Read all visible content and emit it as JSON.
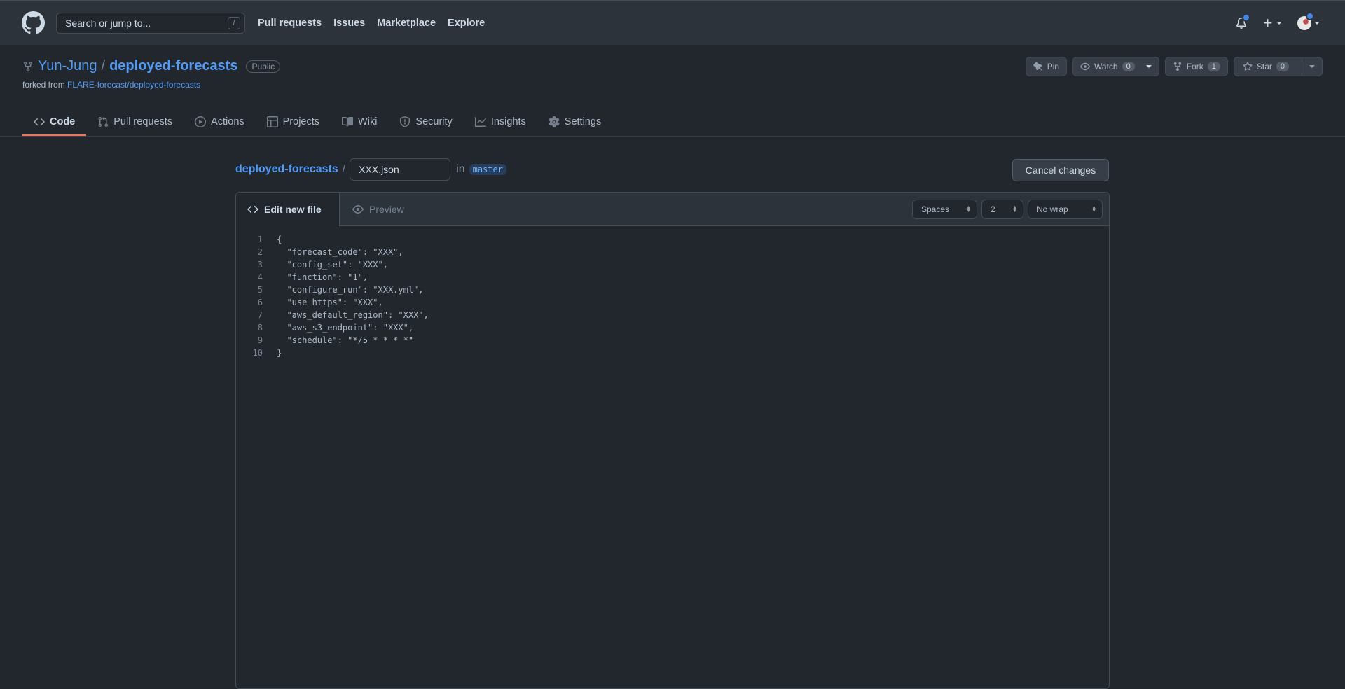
{
  "colors": {
    "accent": "#539bf5",
    "tab_underline": "#ec775c",
    "notification_dot": "#4184e4"
  },
  "header": {
    "search_placeholder": "Search or jump to...",
    "search_shortcut": "/",
    "nav": [
      "Pull requests",
      "Issues",
      "Marketplace",
      "Explore"
    ]
  },
  "repo": {
    "owner": "Yun-Jung",
    "separator": "/",
    "name": "deployed-forecasts",
    "visibility": "Public",
    "forked_label": "forked from",
    "forked_from": "FLARE-forecast/deployed-forecasts",
    "pin_label": "Pin",
    "watch_label": "Watch",
    "watch_count": "0",
    "fork_label": "Fork",
    "fork_count": "1",
    "star_label": "Star",
    "star_count": "0",
    "tabs": [
      "Code",
      "Pull requests",
      "Actions",
      "Projects",
      "Wiki",
      "Security",
      "Insights",
      "Settings"
    ]
  },
  "editor": {
    "crumb_repo": "deployed-forecasts",
    "crumb_sep": "/",
    "filename": "XXX.json",
    "in_label": "in",
    "branch": "master",
    "cancel_label": "Cancel changes",
    "tab_edit": "Edit new file",
    "tab_preview": "Preview",
    "indent_mode": "Spaces",
    "indent_size": "2",
    "wrap_mode": "No wrap",
    "lines": [
      {
        "n": "1",
        "text": "{"
      },
      {
        "n": "2",
        "text": "  \"forecast_code\": \"XXX\","
      },
      {
        "n": "3",
        "text": "  \"config_set\": \"XXX\","
      },
      {
        "n": "4",
        "text": "  \"function\": \"1\","
      },
      {
        "n": "5",
        "text": "  \"configure_run\": \"XXX.yml\","
      },
      {
        "n": "6",
        "text": "  \"use_https\": \"XXX\","
      },
      {
        "n": "7",
        "text": "  \"aws_default_region\": \"XXX\","
      },
      {
        "n": "8",
        "text": "  \"aws_s3_endpoint\": \"XXX\","
      },
      {
        "n": "9",
        "text": "  \"schedule\": \"*/5 * * * *\""
      },
      {
        "n": "10",
        "text": "}"
      }
    ]
  }
}
